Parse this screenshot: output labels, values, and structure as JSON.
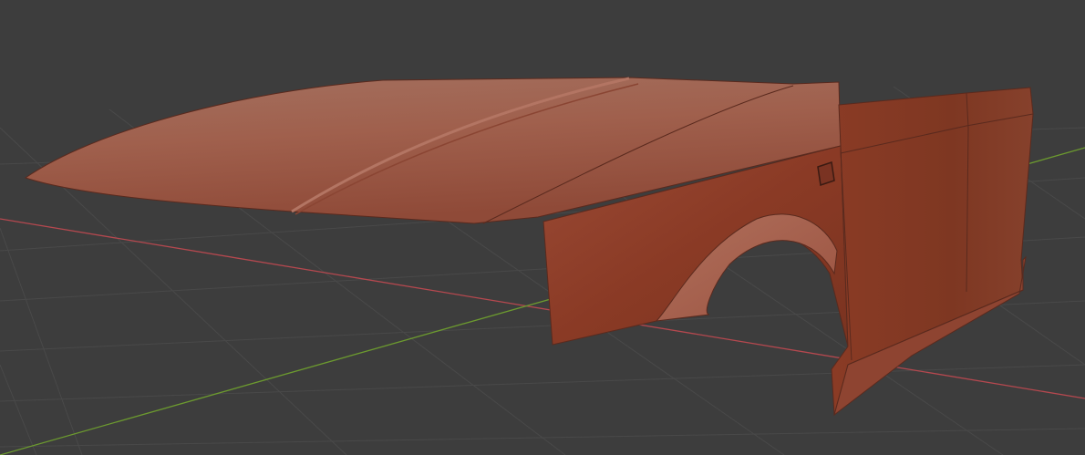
{
  "viewport": {
    "background": "#3d3d3d",
    "grid_color": "#4a4a4a",
    "x_axis_color": "#b5484f",
    "y_axis_color": "#6c9a2f",
    "editor": "3D Viewport",
    "mesh": "car-body-shell",
    "material_color": "#a0513e"
  }
}
